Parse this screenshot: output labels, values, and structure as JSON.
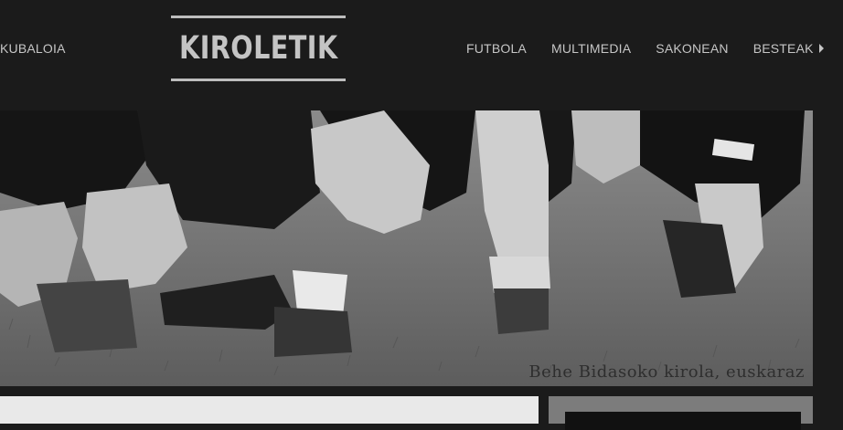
{
  "nav_left": {
    "label": "KUBALOIA"
  },
  "logo": {
    "text": "KIROLETIK"
  },
  "nav_right": {
    "items": [
      "FUTBOLA",
      "MULTIMEDIA",
      "SAKONEAN",
      "BESTEAK"
    ],
    "more_icon": "caret-right-icon"
  },
  "banner": {
    "caption": "Behe Bidasoko kirola, euskaraz"
  },
  "colors": {
    "background": "#1b1b1b",
    "nav_text": "#c6c6c6",
    "logo_border": "#bdbdbd"
  }
}
